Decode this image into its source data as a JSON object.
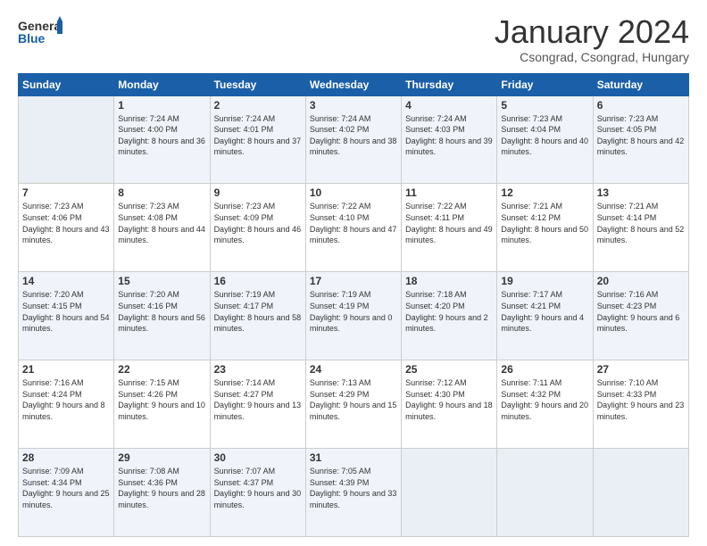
{
  "header": {
    "logo_general": "General",
    "logo_blue": "Blue",
    "title": "January 2024",
    "location": "Csongrad, Csongrad, Hungary"
  },
  "days_of_week": [
    "Sunday",
    "Monday",
    "Tuesday",
    "Wednesday",
    "Thursday",
    "Friday",
    "Saturday"
  ],
  "weeks": [
    [
      {
        "day": "",
        "sunrise": "",
        "sunset": "",
        "daylight": "",
        "empty": true
      },
      {
        "day": "1",
        "sunrise": "Sunrise: 7:24 AM",
        "sunset": "Sunset: 4:00 PM",
        "daylight": "Daylight: 8 hours and 36 minutes."
      },
      {
        "day": "2",
        "sunrise": "Sunrise: 7:24 AM",
        "sunset": "Sunset: 4:01 PM",
        "daylight": "Daylight: 8 hours and 37 minutes."
      },
      {
        "day": "3",
        "sunrise": "Sunrise: 7:24 AM",
        "sunset": "Sunset: 4:02 PM",
        "daylight": "Daylight: 8 hours and 38 minutes."
      },
      {
        "day": "4",
        "sunrise": "Sunrise: 7:24 AM",
        "sunset": "Sunset: 4:03 PM",
        "daylight": "Daylight: 8 hours and 39 minutes."
      },
      {
        "day": "5",
        "sunrise": "Sunrise: 7:23 AM",
        "sunset": "Sunset: 4:04 PM",
        "daylight": "Daylight: 8 hours and 40 minutes."
      },
      {
        "day": "6",
        "sunrise": "Sunrise: 7:23 AM",
        "sunset": "Sunset: 4:05 PM",
        "daylight": "Daylight: 8 hours and 42 minutes."
      }
    ],
    [
      {
        "day": "7",
        "sunrise": "Sunrise: 7:23 AM",
        "sunset": "Sunset: 4:06 PM",
        "daylight": "Daylight: 8 hours and 43 minutes."
      },
      {
        "day": "8",
        "sunrise": "Sunrise: 7:23 AM",
        "sunset": "Sunset: 4:08 PM",
        "daylight": "Daylight: 8 hours and 44 minutes."
      },
      {
        "day": "9",
        "sunrise": "Sunrise: 7:23 AM",
        "sunset": "Sunset: 4:09 PM",
        "daylight": "Daylight: 8 hours and 46 minutes."
      },
      {
        "day": "10",
        "sunrise": "Sunrise: 7:22 AM",
        "sunset": "Sunset: 4:10 PM",
        "daylight": "Daylight: 8 hours and 47 minutes."
      },
      {
        "day": "11",
        "sunrise": "Sunrise: 7:22 AM",
        "sunset": "Sunset: 4:11 PM",
        "daylight": "Daylight: 8 hours and 49 minutes."
      },
      {
        "day": "12",
        "sunrise": "Sunrise: 7:21 AM",
        "sunset": "Sunset: 4:12 PM",
        "daylight": "Daylight: 8 hours and 50 minutes."
      },
      {
        "day": "13",
        "sunrise": "Sunrise: 7:21 AM",
        "sunset": "Sunset: 4:14 PM",
        "daylight": "Daylight: 8 hours and 52 minutes."
      }
    ],
    [
      {
        "day": "14",
        "sunrise": "Sunrise: 7:20 AM",
        "sunset": "Sunset: 4:15 PM",
        "daylight": "Daylight: 8 hours and 54 minutes."
      },
      {
        "day": "15",
        "sunrise": "Sunrise: 7:20 AM",
        "sunset": "Sunset: 4:16 PM",
        "daylight": "Daylight: 8 hours and 56 minutes."
      },
      {
        "day": "16",
        "sunrise": "Sunrise: 7:19 AM",
        "sunset": "Sunset: 4:17 PM",
        "daylight": "Daylight: 8 hours and 58 minutes."
      },
      {
        "day": "17",
        "sunrise": "Sunrise: 7:19 AM",
        "sunset": "Sunset: 4:19 PM",
        "daylight": "Daylight: 9 hours and 0 minutes."
      },
      {
        "day": "18",
        "sunrise": "Sunrise: 7:18 AM",
        "sunset": "Sunset: 4:20 PM",
        "daylight": "Daylight: 9 hours and 2 minutes."
      },
      {
        "day": "19",
        "sunrise": "Sunrise: 7:17 AM",
        "sunset": "Sunset: 4:21 PM",
        "daylight": "Daylight: 9 hours and 4 minutes."
      },
      {
        "day": "20",
        "sunrise": "Sunrise: 7:16 AM",
        "sunset": "Sunset: 4:23 PM",
        "daylight": "Daylight: 9 hours and 6 minutes."
      }
    ],
    [
      {
        "day": "21",
        "sunrise": "Sunrise: 7:16 AM",
        "sunset": "Sunset: 4:24 PM",
        "daylight": "Daylight: 9 hours and 8 minutes."
      },
      {
        "day": "22",
        "sunrise": "Sunrise: 7:15 AM",
        "sunset": "Sunset: 4:26 PM",
        "daylight": "Daylight: 9 hours and 10 minutes."
      },
      {
        "day": "23",
        "sunrise": "Sunrise: 7:14 AM",
        "sunset": "Sunset: 4:27 PM",
        "daylight": "Daylight: 9 hours and 13 minutes."
      },
      {
        "day": "24",
        "sunrise": "Sunrise: 7:13 AM",
        "sunset": "Sunset: 4:29 PM",
        "daylight": "Daylight: 9 hours and 15 minutes."
      },
      {
        "day": "25",
        "sunrise": "Sunrise: 7:12 AM",
        "sunset": "Sunset: 4:30 PM",
        "daylight": "Daylight: 9 hours and 18 minutes."
      },
      {
        "day": "26",
        "sunrise": "Sunrise: 7:11 AM",
        "sunset": "Sunset: 4:32 PM",
        "daylight": "Daylight: 9 hours and 20 minutes."
      },
      {
        "day": "27",
        "sunrise": "Sunrise: 7:10 AM",
        "sunset": "Sunset: 4:33 PM",
        "daylight": "Daylight: 9 hours and 23 minutes."
      }
    ],
    [
      {
        "day": "28",
        "sunrise": "Sunrise: 7:09 AM",
        "sunset": "Sunset: 4:34 PM",
        "daylight": "Daylight: 9 hours and 25 minutes."
      },
      {
        "day": "29",
        "sunrise": "Sunrise: 7:08 AM",
        "sunset": "Sunset: 4:36 PM",
        "daylight": "Daylight: 9 hours and 28 minutes."
      },
      {
        "day": "30",
        "sunrise": "Sunrise: 7:07 AM",
        "sunset": "Sunset: 4:37 PM",
        "daylight": "Daylight: 9 hours and 30 minutes."
      },
      {
        "day": "31",
        "sunrise": "Sunrise: 7:05 AM",
        "sunset": "Sunset: 4:39 PM",
        "daylight": "Daylight: 9 hours and 33 minutes."
      },
      {
        "day": "",
        "sunrise": "",
        "sunset": "",
        "daylight": "",
        "empty": true
      },
      {
        "day": "",
        "sunrise": "",
        "sunset": "",
        "daylight": "",
        "empty": true
      },
      {
        "day": "",
        "sunrise": "",
        "sunset": "",
        "daylight": "",
        "empty": true
      }
    ]
  ]
}
